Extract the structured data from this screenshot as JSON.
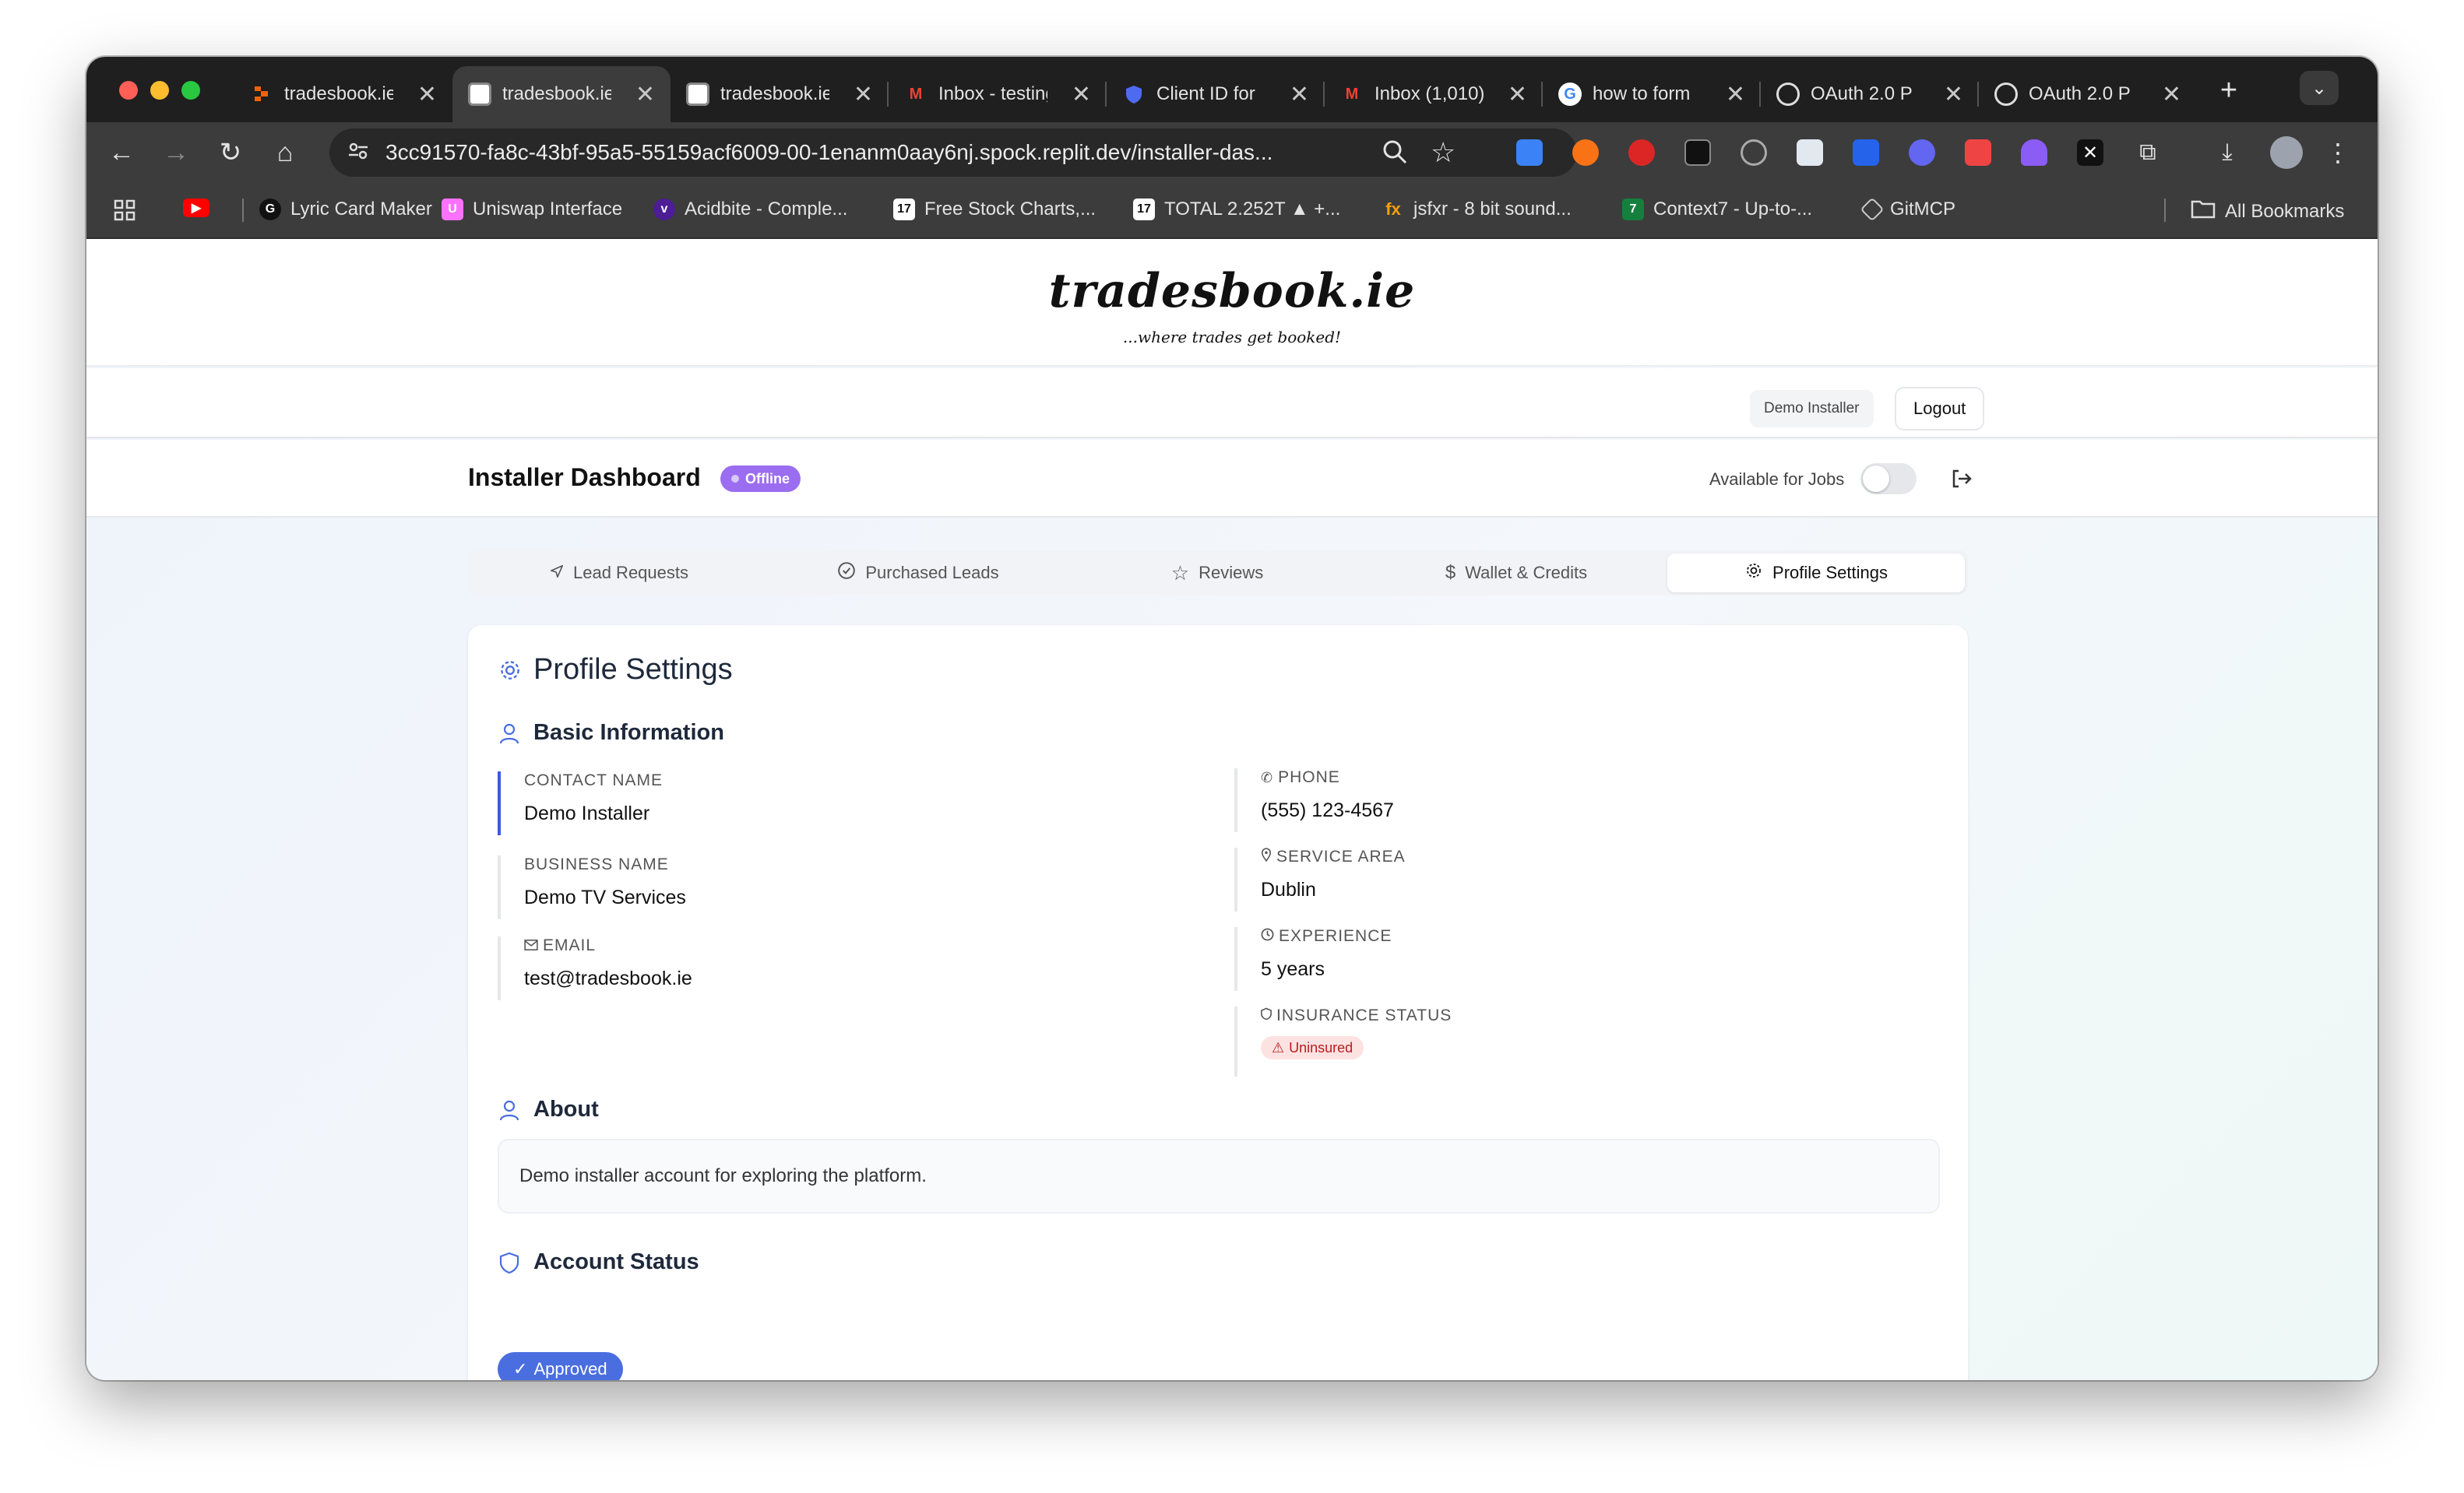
{
  "browser": {
    "tabs": [
      {
        "title": "tradesbook.ie",
        "favicon": "replit-icon",
        "active": false
      },
      {
        "title": "tradesbook.ie",
        "favicon": "page-icon",
        "active": true
      },
      {
        "title": "tradesbook.ie",
        "favicon": "page-icon",
        "active": false
      },
      {
        "title": "Inbox - testing",
        "favicon": "gmail-icon",
        "active": false
      },
      {
        "title": "Client ID for",
        "favicon": "shield-icon",
        "active": false
      },
      {
        "title": "Inbox (1,010)",
        "favicon": "gmail-icon",
        "active": false
      },
      {
        "title": "how to form",
        "favicon": "google-icon",
        "active": false
      },
      {
        "title": "OAuth 2.0 P",
        "favicon": "openai-icon",
        "active": false
      },
      {
        "title": "OAuth 2.0 P",
        "favicon": "openai-icon",
        "active": false
      }
    ],
    "close_glyph": "✕",
    "new_tab_glyph": "+",
    "url": "3cc91570-fa8c-43bf-95a5-55159acf6009-00-1enanm0aay6nj.spock.replit.dev/installer-das...",
    "bookmarks": [
      {
        "label": "Lyric Card Maker"
      },
      {
        "label": "Uniswap Interface"
      },
      {
        "label": "Acidbite - Comple..."
      },
      {
        "label": "Free Stock Charts,..."
      },
      {
        "label": "TOTAL 2.252T ▲ +..."
      },
      {
        "label": "jsfxr - 8 bit sound..."
      },
      {
        "label": "Context7 - Up-to-..."
      },
      {
        "label": "GitMCP"
      }
    ],
    "all_bookmarks": "All Bookmarks"
  },
  "site": {
    "logo": "tradesbook.ie",
    "tagline": "...where trades get booked!",
    "user_chip": "Demo Installer",
    "logout": "Logout"
  },
  "dashboard": {
    "title": "Installer Dashboard",
    "status_badge": "Offline",
    "availability_label": "Available for Jobs",
    "availability_on": false
  },
  "nav": {
    "tabs": [
      {
        "label": "Lead Requests",
        "icon": "send-icon"
      },
      {
        "label": "Purchased Leads",
        "icon": "check-circle-icon"
      },
      {
        "label": "Reviews",
        "icon": "star-icon"
      },
      {
        "label": "Wallet & Credits",
        "icon": "dollar-icon"
      },
      {
        "label": "Profile Settings",
        "icon": "gear-icon"
      }
    ],
    "active_index": 4
  },
  "profile": {
    "title": "Profile Settings",
    "basic_title": "Basic Information",
    "contact_name": {
      "label": "CONTACT NAME",
      "value": "Demo Installer"
    },
    "business_name": {
      "label": "BUSINESS NAME",
      "value": "Demo TV Services"
    },
    "email": {
      "label": "EMAIL",
      "value": "test@tradesbook.ie"
    },
    "phone": {
      "label": "PHONE",
      "value": "(555) 123-4567"
    },
    "service_area": {
      "label": "SERVICE AREA",
      "value": "Dublin"
    },
    "experience": {
      "label": "EXPERIENCE",
      "value": "5 years"
    },
    "insurance": {
      "label": "INSURANCE STATUS",
      "value": "Uninsured"
    },
    "about_title": "About",
    "about_text": "Demo installer account for exploring the platform.",
    "account_status_title": "Account Status",
    "account_status": "Approved"
  },
  "colors": {
    "accent": "#4a6ee0",
    "offline_badge": "#9b6df0",
    "uninsured_bg": "#fde2e2",
    "uninsured_text": "#b91c1c"
  }
}
